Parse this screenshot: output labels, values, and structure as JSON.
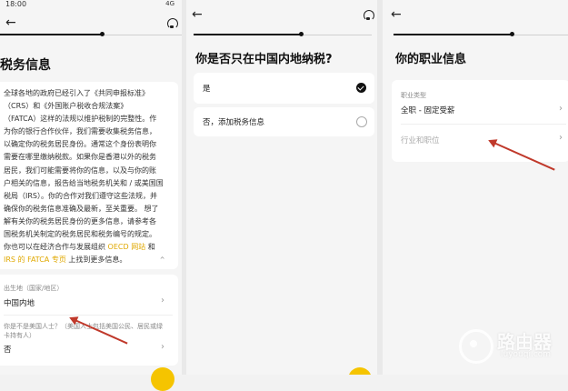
{
  "panel1": {
    "status_time": "18:00",
    "status_signal": "4G",
    "title": "税务信息",
    "intro_lines": [
      "全球各地的政府已经引入了《共同申报标准》",
      "（CRS）和《外国账户税收合规法案》",
      "（FATCA）这样的法规以维护税制的完整性。作",
      "为你的银行合作伙伴，我们需要收集税务信息，",
      "以确定你的税务居民身份。通常这个身份表明你",
      "需要在哪里缴纳税款。如果你是香港以外的税务",
      "居民，我们可能需要将你的信息，以及与你的账",
      "户相关的信息，报告给当地税务机关和 / 或美国国",
      "税局（IRS）。你的合作对我们遵守这些法规，并",
      "确保你的税务信息准确及最新，至关重要。 想了",
      "解有关你的税务居民身份的更多信息，请参考各",
      "国税务机关制定的税务居民和税务编号的规定。"
    ],
    "line13_before": "你也可以在经济合作与发展组织",
    "line13_link": "OECD 网站",
    "line13_after": "和",
    "line14_link": "IRS 的 FATCA 专页",
    "line14_after": "上找到更多信息。",
    "birthplace_label": "出生地（国家/地区）",
    "birthplace_value": "中国内地",
    "us_question_line1": "你是不是美国人士？（美国人士包括美国公民、居民或绿",
    "us_question_line2": "卡持有人）",
    "us_answer": "否"
  },
  "panel2": {
    "question": "你是否只在中国内地纳税?",
    "option_yes": "是",
    "option_no": "否，添加税务信息"
  },
  "panel3": {
    "title": "你的职业信息",
    "job_type_label": "职业类型",
    "job_type_value": "全职 - 固定受薪",
    "industry_placeholder": "行业和职位"
  },
  "watermark": {
    "title": "路由器",
    "domain": "luyouqi.com"
  },
  "colors": {
    "accent": "#f5c400",
    "link": "#e0a800",
    "annotation_arrow": "#c0392b"
  }
}
